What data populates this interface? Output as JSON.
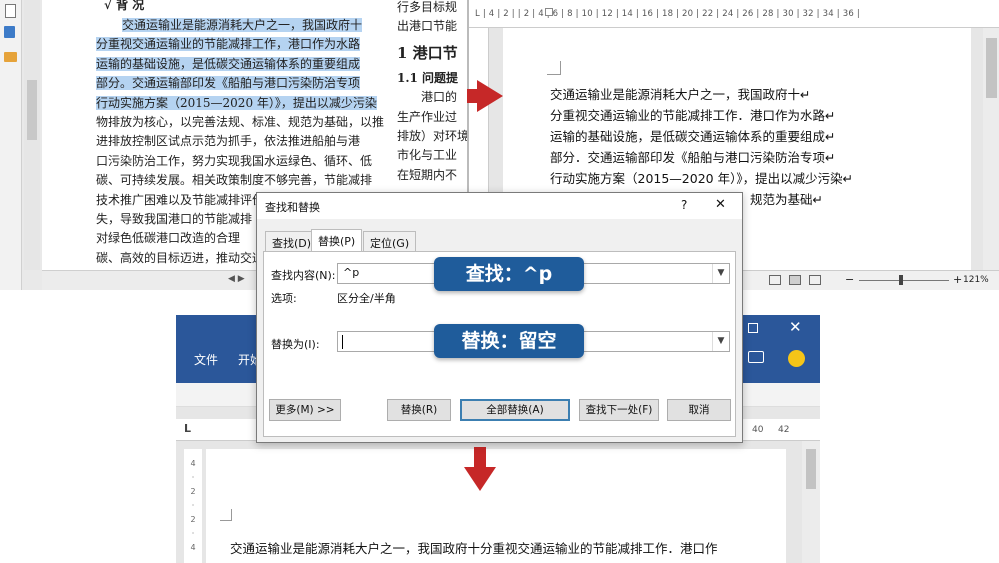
{
  "left_doc": {
    "heading_partial": "√ 背 况",
    "lines": [
      "交通运输业是能源消耗大户之一，我国政府十",
      "分重视交通运输业的节能减排工作，港口作为水路",
      "运输的基础设施，是低碳交通运输体系的重要组成",
      "部分。交通运输部印发《船舶与港口污染防治专项",
      "行动实施方案（2015—2020 年）》，提出以减少污染",
      "物排放为核心，以完善法规、标准、规范为基础，以推",
      "进排放控制区试点示范为抓手，依法推进船舶与港",
      "口污染防治工作，努力实现我国水运绿色、循环、低",
      "碳、可持续发展。相关政策制度不够完善，节能减排",
      "技术推广困难以及节能减排评价体系标准缺",
      "失，导致我国港口的节能减排",
      "对绿色低碳港口改造的合理",
      "碳、高效的目标迈进，推动交通"
    ],
    "col2": [
      "行多目标规",
      "出港口节能",
      "1 港口节",
      "1.1 问题提",
      "港口的",
      "生产作业过",
      "排放）对环境",
      "市化与工业",
      "在短期内不"
    ]
  },
  "right_doc": {
    "ruler": "L | 4 | 2 | | 2 | 4 | 6 | 8 | 10 | 12 | 14 | 16 | 18 | 20 | 22 | 24 | 26 | 28 | 30 | 32 | 34 | 36 |",
    "lines": [
      "交通运输业是能源消耗大户之一，我国政府十↵",
      "分重视交通运输业的节能减排工作．港口作为水路↵",
      "运输的基础设施，是低碳交通运输体系的重要组成↵",
      "部分．交通运输部印发《船舶与港口污染防治专项↵",
      "行动实施方案（2015—2020 年）》，提出以减少污染↵",
      "物排放为核心，以完善法规、标准、规范为基础↵"
    ],
    "zoom": "121%"
  },
  "bottom_doc": {
    "tabs": [
      "文件",
      "开始"
    ],
    "ruler_marks": [
      "40",
      "42"
    ],
    "line": "交通运输业是能源消耗大户之一，我国政府十分重视交通运输业的节能减排工作．港口作"
  },
  "dialog": {
    "title": "查找和替换",
    "help": "?",
    "close": "✕",
    "tabs": [
      "查找(D)",
      "替换(P)",
      "定位(G)"
    ],
    "find_label": "查找内容(N):",
    "find_value": "^p",
    "options_label": "选项:",
    "options_value": "区分全/半角",
    "replace_label": "替换为(I):",
    "replace_value": "",
    "more_btn": "更多(M) >>",
    "replace_btn": "替换(R)",
    "replace_all_btn": "全部替换(A)",
    "find_next_btn": "查找下一处(F)",
    "cancel_btn": "取消"
  },
  "callouts": {
    "find": "查找：^p",
    "replace": "替换：留空"
  },
  "colors": {
    "highlight": "#b5d3f1",
    "callout": "#1f5c9b",
    "arrow": "#c62828",
    "ribbon": "#2b579a"
  }
}
